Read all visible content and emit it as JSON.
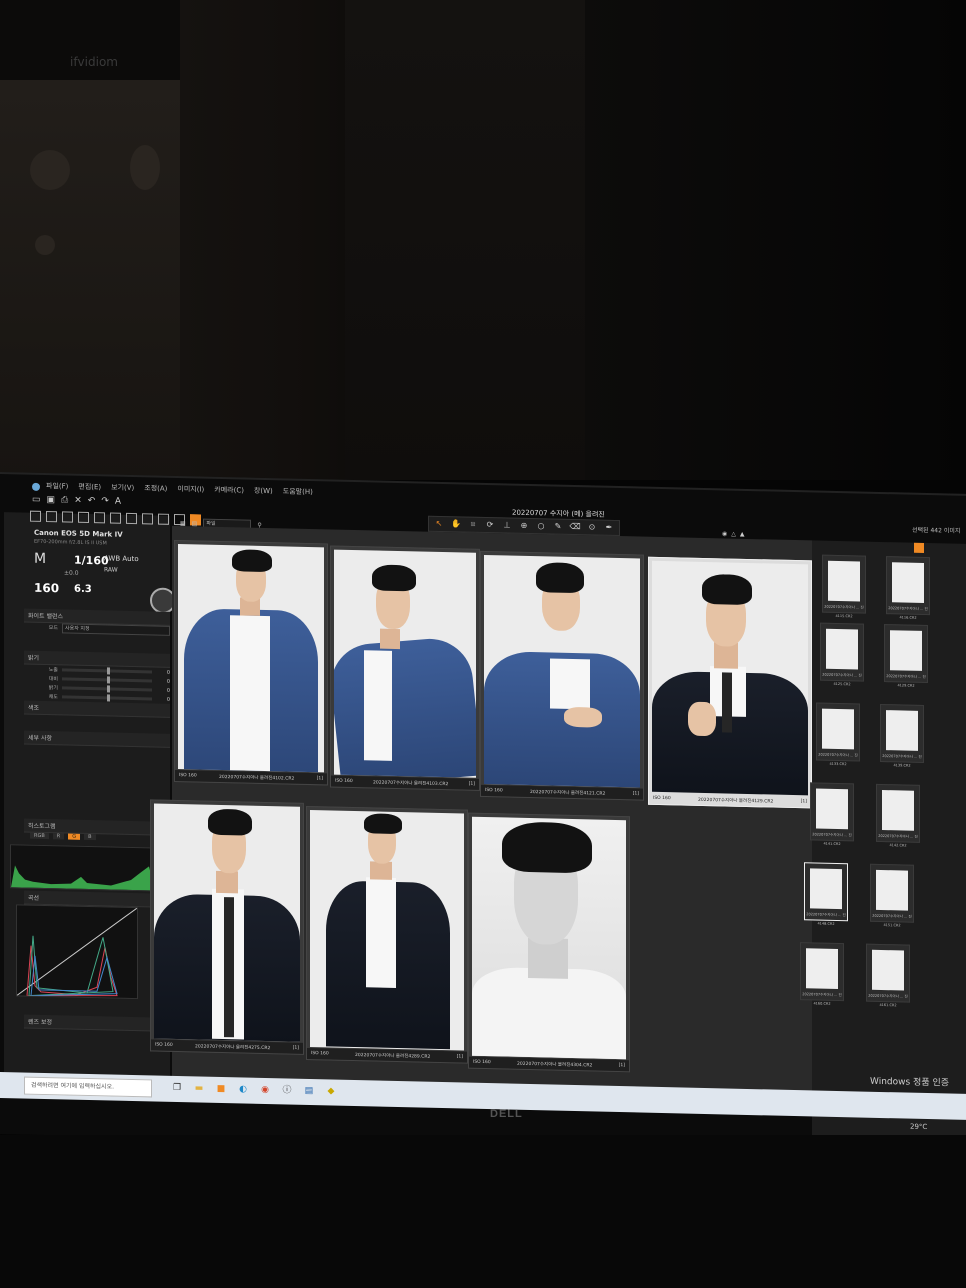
{
  "room": {
    "banner_text": "ifvidiom"
  },
  "monitor": {
    "brand": "DELL"
  },
  "app": {
    "menu": [
      "파일(F)",
      "편집(E)",
      "보기(V)",
      "조정(A)",
      "이미지(I)",
      "카메라(C)",
      "창(W)",
      "도움말(H)"
    ],
    "window_title": "20220707 수지아 (메) 을려진"
  },
  "left": {
    "camera_model": "Canon EOS 5D Mark IV",
    "lens": "EF70-200mm f/2.8L IS II USM",
    "mode": "M",
    "shutter": "1/160",
    "ev": "±0.0",
    "iso": "160",
    "aperture": "6.3",
    "wb": "AWB Auto",
    "quality": "RAW",
    "sections": {
      "white_balance": "화이트 밸런스",
      "wb_mode_label": "모드",
      "wb_mode_value": "사용자 지정",
      "brightness": "밝기",
      "color": "색조",
      "detail": "세부 사항",
      "histogram": "히스토그램",
      "curve": "곡선",
      "lens": "렌즈 보정"
    },
    "rows": [
      {
        "label": "노출",
        "value": "0"
      },
      {
        "label": "대비",
        "value": "0"
      },
      {
        "label": "밝기",
        "value": "0"
      },
      {
        "label": "채도",
        "value": "0"
      }
    ],
    "hist_tabs": [
      "RGB",
      "R",
      "G",
      "B"
    ],
    "curve_tabs": [
      "RGB",
      "R",
      "G",
      "B",
      "그림"
    ]
  },
  "grid": {
    "sort_label": "파일",
    "thumbs": [
      {
        "iso": "ISO 160",
        "file": "20220707수지아나 을려진4102.CR2",
        "num": "[1]"
      },
      {
        "iso": "ISO 160",
        "file": "20220707수지아나 을려진4103.CR2",
        "num": "[1]"
      },
      {
        "iso": "ISO 160",
        "file": "20220707수지아나 을려진4121.CR2",
        "num": "[1]"
      },
      {
        "iso": "ISO 160",
        "file": "20220707수지아나 을려진4129.CR2",
        "num": "[1]"
      },
      {
        "iso": "ISO 160",
        "file": "20220707수지아나 을려진4275.CR2",
        "num": "[1]"
      },
      {
        "iso": "ISO 160",
        "file": "20220707수지아나 을려진4289.CR2",
        "num": "[1]"
      },
      {
        "iso": "ISO 160",
        "file": "20220707수지아나 을려진4304.CR2",
        "num": "[1]"
      }
    ]
  },
  "right": {
    "header": "선택된 442 이미지",
    "minis": [
      "20220707수지아나 ... 진4115.CR2",
      "20220707수지아나 ... 진4116.CR2",
      "20220707수지아나 ... 진4125.CR2",
      "20220707수지아나 ... 진4129.CR2",
      "20220707수지아나 ... 진4133.CR2",
      "20220707수지아나 ... 진4139.CR2",
      "20220707수지아나 ... 진4141.CR2",
      "20220707수지아나 ... 진4142.CR2",
      "20220707수지아나 ... 진4148.CR2",
      "20220707수지아나 ... 진4151.CR2",
      "20220707수지아나 ... 진4160.CR2",
      "20220707수지아나 ... 진4161.CR2"
    ]
  },
  "taskbar": {
    "search_placeholder": "검색하려면 여기에 입력하십시오.",
    "watermark": "Windows 정품 인증",
    "temperature": "29°C"
  }
}
